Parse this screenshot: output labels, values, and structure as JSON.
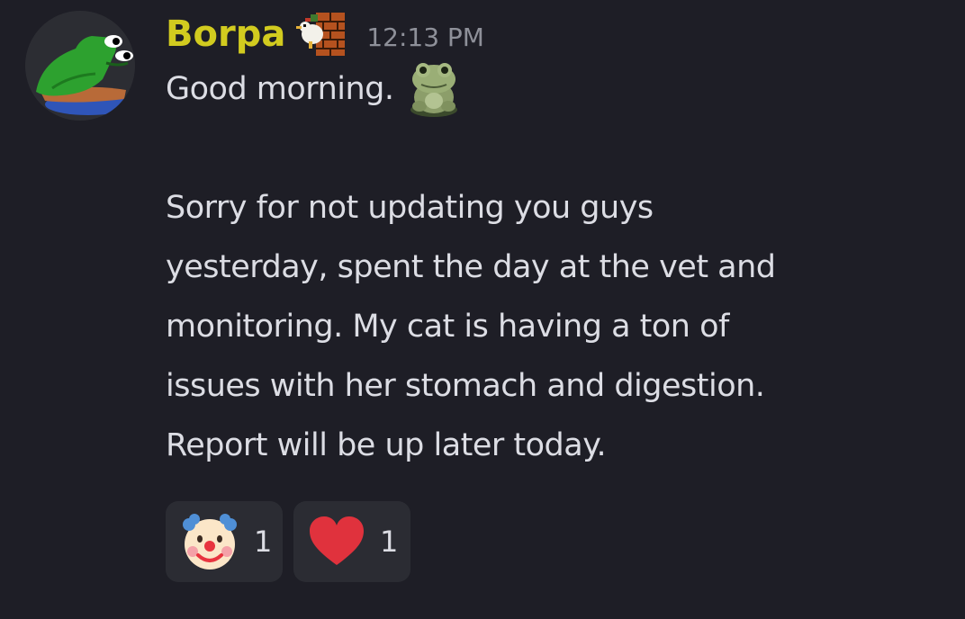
{
  "message": {
    "author": "Borpa",
    "author_color": "#d2cb1f",
    "timestamp": "12:13 PM",
    "role_icon": "pixel-bird-brick-icon",
    "avatar_icon": "green-frog-avatar-icon",
    "lines": [
      "Good morning.",
      "",
      "Sorry for not updating you guys",
      "yesterday, spent the day at the vet and",
      "monitoring. My cat is having a ton of",
      "issues with her stomach and digestion.",
      "Report will be up later today."
    ],
    "inline_emoji": "frog-sitting-emoji"
  },
  "reactions": [
    {
      "emoji": "clown-face-emoji",
      "count": "1"
    },
    {
      "emoji": "red-heart-emoji",
      "count": "1"
    }
  ],
  "colors": {
    "background": "#1e1e26",
    "text": "#dcdde4",
    "muted": "#8e9099",
    "reaction_bg": "#2b2c33"
  }
}
